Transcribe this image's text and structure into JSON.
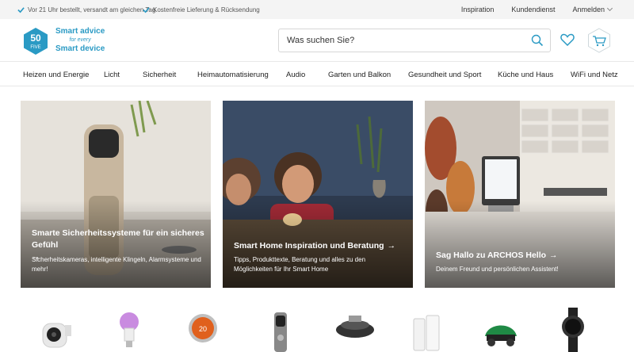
{
  "topbar": {
    "usp": [
      "Vor 21 Uhr bestellt, versandt am gleichen Tag",
      "Kostenfreie Lieferung & Rücksendung"
    ],
    "links": {
      "inspiration": "Inspiration",
      "service": "Kundendienst",
      "login": "Anmelden"
    },
    "check_color": "#2a9ac4"
  },
  "header": {
    "logo": {
      "badge_top": "50",
      "badge_bottom": "FIVE",
      "line1": "Smart advice",
      "line2": "for every",
      "line3": "Smart device"
    },
    "search": {
      "placeholder": "Was suchen Sie?"
    },
    "icons": [
      "search-icon",
      "heart-icon",
      "cart-icon"
    ],
    "accent": "#2a9ac4"
  },
  "nav": {
    "items": [
      "Heizen und Energie",
      "Licht",
      "Sicherheit",
      "Heimautomatisierung",
      "Audio",
      "Garten und Balkon",
      "Gesundheit und Sport",
      "Küche und Haus",
      "WiFi und Netz"
    ]
  },
  "hero": {
    "cards": [
      {
        "title": "Smarte Sicherheitssysteme für ein sicheres Gefühl",
        "desc": "Sicherheitskameras, intelligente Klingeln, Alarmsysteme und mehr!"
      },
      {
        "title": "Smart Home Inspiration und Beratung",
        "desc": "Tipps, Produkttexte, Beratung und alles zu den Möglichkeiten für Ihr Smart Home"
      },
      {
        "title": "Sag Hallo zu ARCHOS Hello",
        "desc": "Deinem Freund und persönlichen Assistent!"
      }
    ],
    "arrow": "→"
  },
  "products": {
    "items": [
      "security-camera",
      "smart-bulb",
      "smart-thermostat",
      "video-doorbell",
      "robot-vacuum",
      "wifi-mesh-system",
      "robotic-lawn-mower",
      "smartwatch"
    ],
    "thermostat_value": "20"
  }
}
